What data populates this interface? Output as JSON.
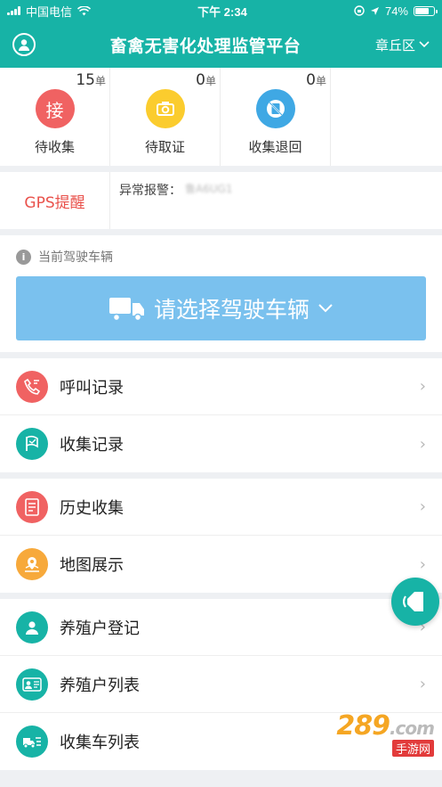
{
  "status_bar": {
    "carrier": "中国电信",
    "time": "下午 2:34",
    "battery": "74%"
  },
  "header": {
    "title": "畜禽无害化处理监管平台",
    "region": "章丘区"
  },
  "stats": [
    {
      "count": "15",
      "unit": "单",
      "icon_text": "接",
      "label": "待收集",
      "color": "#f06262"
    },
    {
      "count": "0",
      "unit": "单",
      "label": "待取证",
      "color": "#fbcc2e"
    },
    {
      "count": "0",
      "unit": "单",
      "label": "收集退回",
      "color": "#3fa8e4"
    }
  ],
  "alerts": {
    "gps_label": "GPS提醒",
    "abnormal_label": "异常报警：",
    "abnormal_value": "鲁A6UG1"
  },
  "vehicle": {
    "section_label": "当前驾驶车辆",
    "select_label": "请选择驾驶车辆"
  },
  "menu_groups": [
    [
      {
        "label": "呼叫记录",
        "icon": "phone-icon",
        "color": "#f06262"
      },
      {
        "label": "收集记录",
        "icon": "flag-icon",
        "color": "#17b3a6"
      }
    ],
    [
      {
        "label": "历史收集",
        "icon": "document-icon",
        "color": "#f06262"
      },
      {
        "label": "地图展示",
        "icon": "map-pin-icon",
        "color": "#f7a93b"
      }
    ],
    [
      {
        "label": "养殖户登记",
        "icon": "user-icon",
        "color": "#17b3a6"
      },
      {
        "label": "养殖户列表",
        "icon": "user-card-icon",
        "color": "#17b3a6"
      },
      {
        "label": "收集车列表",
        "icon": "truck-list-icon",
        "color": "#17b3a6"
      }
    ]
  ],
  "watermark": {
    "main": "289",
    "suffix": ".com",
    "sub": "手游网"
  }
}
